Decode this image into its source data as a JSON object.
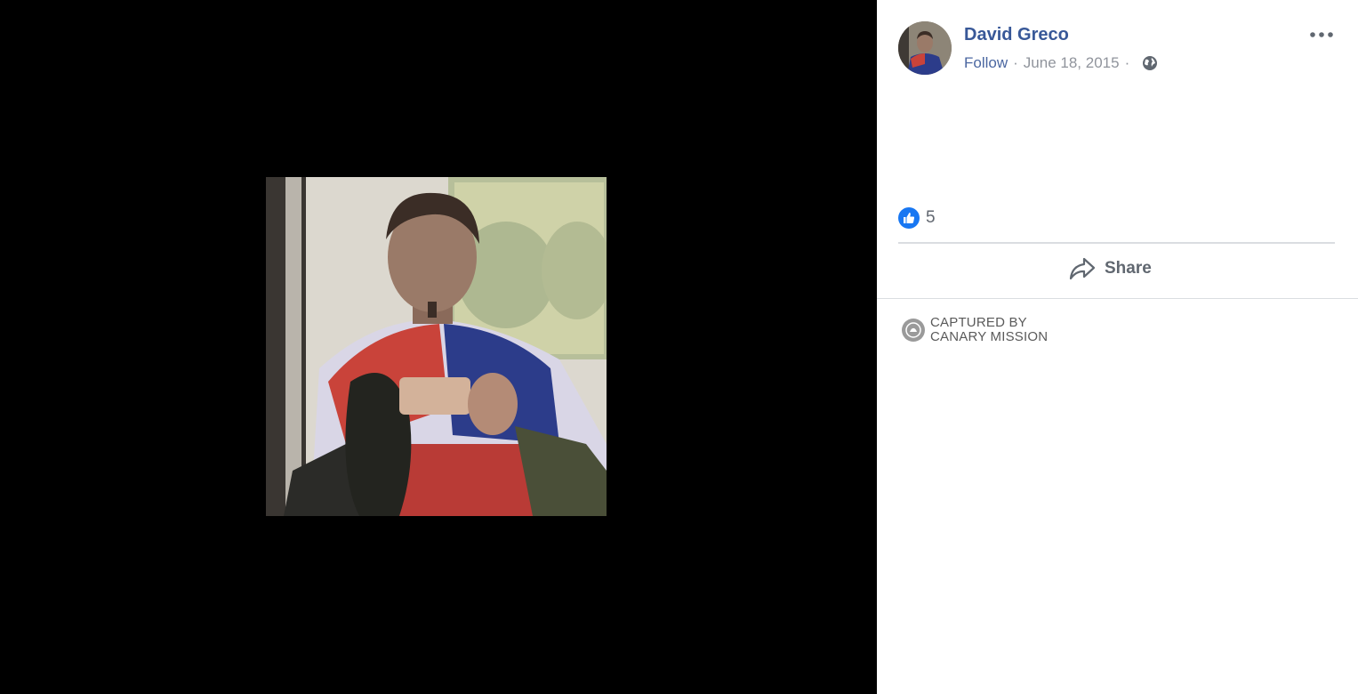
{
  "post": {
    "author": "David Greco",
    "follow_label": "Follow",
    "separator": "·",
    "date": "June 18, 2015",
    "privacy_icon": "globe-icon",
    "more_icon": "ellipsis-icon"
  },
  "reactions": {
    "icon": "like-icon",
    "count": "5"
  },
  "actions": {
    "share_label": "Share",
    "share_icon": "share-arrow-icon"
  },
  "watermark": {
    "line1": "CAPTURED BY",
    "line2": "CANARY MISSION"
  },
  "colors": {
    "link": "#385898",
    "like": "#1877f2",
    "meta": "#90949c",
    "viewer_bg": "#000000"
  }
}
